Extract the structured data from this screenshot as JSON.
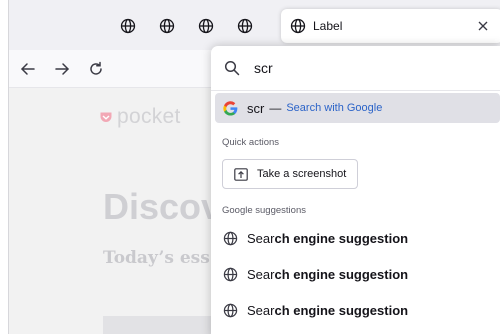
{
  "tabs": {
    "pinned": [
      {
        "icon": "globe-icon"
      },
      {
        "icon": "globe-icon"
      },
      {
        "icon": "globe-icon"
      },
      {
        "icon": "globe-icon"
      }
    ],
    "active": {
      "label": "Label",
      "icon": "globe-icon",
      "close_icon": "close-icon"
    }
  },
  "nav": {
    "back_icon": "back-arrow-icon",
    "forward_icon": "forward-arrow-icon",
    "reload_icon": "reload-icon"
  },
  "page": {
    "logo_text": "pocket",
    "heading": "Discov",
    "subheading": "Today’s ess"
  },
  "urlbar": {
    "query": "scr",
    "search_icon": "search-icon",
    "google_row": {
      "query": "scr",
      "separator": "—",
      "action": "Search with Google",
      "icon": "google-icon"
    },
    "quick_actions": {
      "label": "Quick actions",
      "screenshot_label": "Take a screenshot"
    },
    "suggestions": {
      "label": "Google suggestions",
      "items": [
        {
          "prefix": "Sear",
          "rest": "ch engine suggestion"
        },
        {
          "prefix": "Sear",
          "rest": "ch engine suggestion"
        },
        {
          "prefix": "Sear",
          "rest": "ch engine suggestion"
        }
      ]
    }
  },
  "colors": {
    "accent_link": "#2b63c8",
    "highlight_row": "#e0e0e6",
    "pocket_heart": "#f2a8b5"
  }
}
